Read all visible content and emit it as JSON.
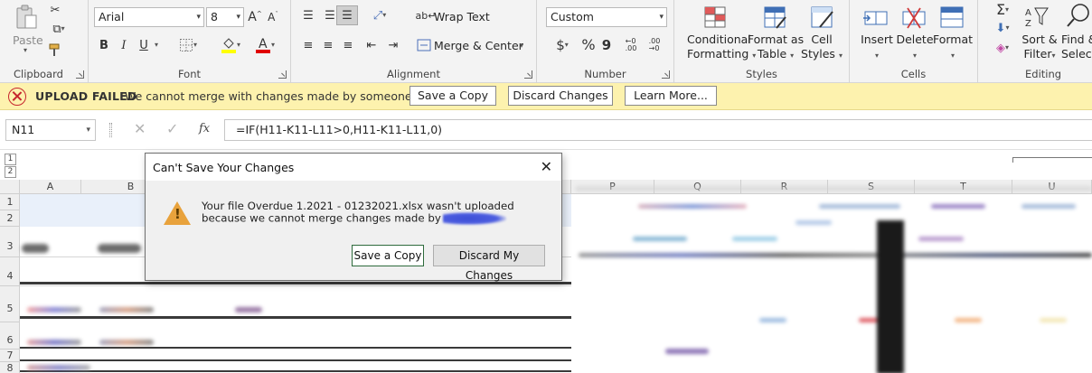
{
  "ribbon": {
    "groups": {
      "clipboard": "Clipboard",
      "font": "Font",
      "alignment": "Alignment",
      "number": "Number",
      "styles": "Styles",
      "cells": "Cells",
      "editing": "Editing"
    },
    "paste_label": "Paste",
    "font_name": "Arial",
    "font_size": "8",
    "bold": "B",
    "italic": "I",
    "underline": "U",
    "wrap_text": "Wrap Text",
    "merge_center": "Merge & Center",
    "number_format": "Custom",
    "currency": "$",
    "percent": "%",
    "comma": "9",
    "conditional_formatting": [
      "Conditional",
      "Formatting"
    ],
    "format_as_table": [
      "Format as",
      "Table"
    ],
    "cell_styles": [
      "Cell",
      "Styles"
    ],
    "insert": "Insert",
    "delete": "Delete",
    "format": "Format",
    "sort_filter": [
      "Sort &",
      "Filter"
    ],
    "find_select": [
      "Find &",
      "Select"
    ]
  },
  "notification": {
    "title": "UPLOAD FAILED",
    "message": "We cannot merge with changes made by someone else.",
    "save_copy": "Save a Copy",
    "discard_changes": "Discard Changes",
    "learn_more": "Learn More..."
  },
  "formula_bar": {
    "name_box": "N11",
    "fx": "fx",
    "formula": "=IF(H11-K11-L11>0,H11-K11-L11,0)"
  },
  "grid": {
    "outline_levels": [
      "1",
      "2"
    ],
    "columns": [
      "A",
      "B",
      "P",
      "Q",
      "R",
      "S",
      "T",
      "U"
    ],
    "rows": [
      "1",
      "2",
      "3",
      "4",
      "5",
      "6",
      "7",
      "8"
    ]
  },
  "dialog": {
    "title": "Can't Save Your Changes",
    "message_line1": "Your file Overdue 1.2021 - 01232021.xlsx wasn't uploaded",
    "message_line2": "because we cannot merge changes made by",
    "save_copy": "Save a Copy",
    "discard": "Discard My Changes"
  },
  "colors": {
    "ribbon_bg": "#f3f3f3",
    "notification_bg": "#fdf2ae",
    "error_red": "#c6262e",
    "warning_orange": "#e8a23c",
    "primary_button_border": "#2e6b3c"
  }
}
